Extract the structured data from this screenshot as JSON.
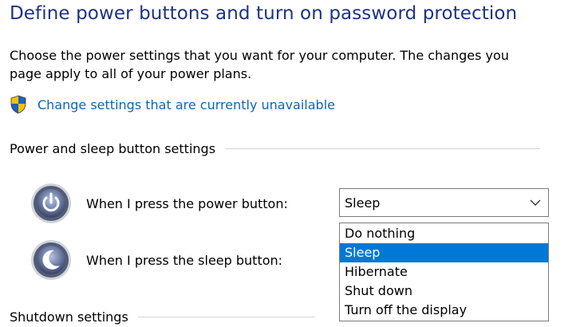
{
  "page_title": "Define power buttons and turn on password protection",
  "description": {
    "line1": "Choose the power settings that you want for your computer. The changes you",
    "line2": "page apply to all of your power plans."
  },
  "change_link": {
    "icon": "uac-shield-icon",
    "label": "Change settings that are currently unavailable"
  },
  "sections": {
    "power_sleep": {
      "title": "Power and sleep button settings",
      "power_button": {
        "icon": "power-button-icon",
        "label": "When I press the power button:",
        "selected": "Sleep"
      },
      "sleep_button": {
        "icon": "sleep-button-icon",
        "label": "When I press the sleep button:"
      }
    },
    "shutdown": {
      "title": "Shutdown settings"
    }
  },
  "dropdown_options": [
    "Do nothing",
    "Sleep",
    "Hibernate",
    "Shut down",
    "Turn off the display"
  ],
  "highlighted_option": "Sleep",
  "colors": {
    "title": "#1e3287",
    "link": "#0a66c2",
    "highlight": "#0078d7",
    "rule": "#d2d2d2"
  }
}
